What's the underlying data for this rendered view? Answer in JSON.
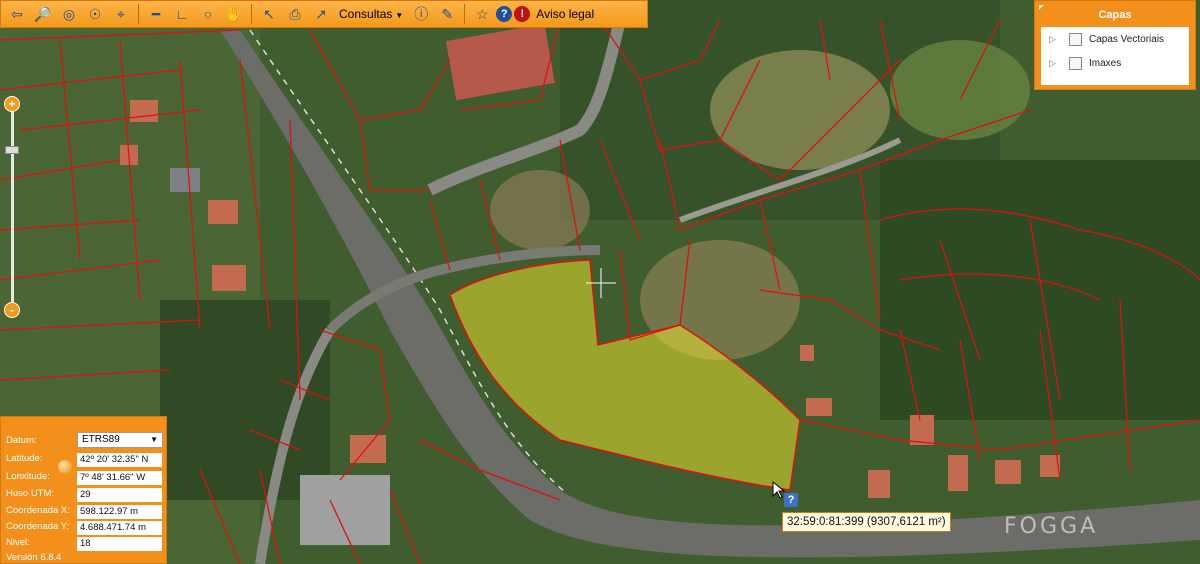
{
  "toolbar": {
    "consultas_label": "Consultas",
    "aviso_label": "Aviso legal",
    "icons": [
      "back-arrow",
      "binoculars",
      "zoom-globe",
      "search-globe",
      "crosshair",
      "ruler",
      "angle",
      "circle",
      "hand",
      "xy-point",
      "print",
      "query-pointer",
      "consultas",
      "info-window",
      "edit-pencil",
      "favorite-star",
      "help",
      "aviso"
    ]
  },
  "layers": {
    "title": "Capas",
    "items": [
      {
        "label": "Capas Vectoriais",
        "checked": false
      },
      {
        "label": "Imaxes",
        "checked": false
      }
    ]
  },
  "info": {
    "datum_label": "Datum:",
    "datum_value": "ETRS89",
    "latitude_label": "Latitude:",
    "latitude_value": "42º 20' 32.35\" N",
    "lonxitude_label": "Lonxitude:",
    "lonxitude_value": "7º 48' 31.66\" W",
    "huso_label": "Huso UTM:",
    "huso_value": "29",
    "coord_x_label": "Coordenada X:",
    "coord_x_value": "598.122.97 m",
    "coord_y_label": "Coordenada Y:",
    "coord_y_value": "4.688.471.74 m",
    "nivel_label": "Nivel:",
    "nivel_value": "18",
    "version": "Versión 6.8.4"
  },
  "measure": {
    "text": "32:59:0:81:399 (9307,6121 m²)",
    "help": "?"
  },
  "watermark": "FOGGA",
  "colors": {
    "accent": "#f39a1c",
    "parcel_line": "#e01010",
    "highlight_fill": "#e8e030"
  }
}
